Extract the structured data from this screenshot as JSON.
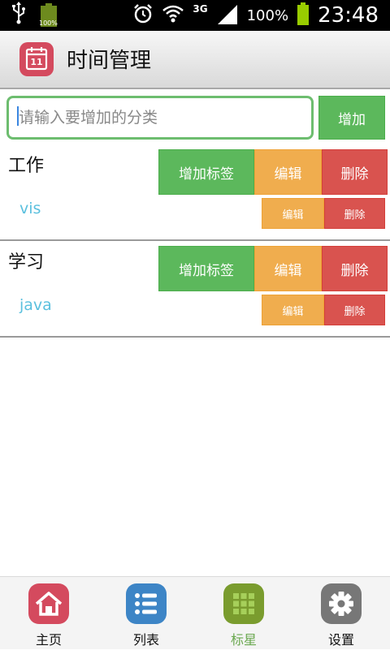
{
  "status_bar": {
    "battery_small_label": "100%",
    "network_type": "3G",
    "battery_percent": "100%",
    "time": "23:48"
  },
  "title_bar": {
    "app_icon_day": "11",
    "title": "时间管理"
  },
  "add_category": {
    "placeholder": "请输入要增加的分类",
    "value": "",
    "button_label": "增加"
  },
  "categories": [
    {
      "name": "工作",
      "add_tag_label": "增加标签",
      "edit_label": "编辑",
      "delete_label": "删除",
      "tags": [
        {
          "name": "vis",
          "edit_label": "编辑",
          "delete_label": "删除"
        }
      ]
    },
    {
      "name": "学习",
      "add_tag_label": "增加标签",
      "edit_label": "编辑",
      "delete_label": "删除",
      "tags": [
        {
          "name": "java",
          "edit_label": "编辑",
          "delete_label": "删除"
        }
      ]
    }
  ],
  "bottom_nav": [
    {
      "label": "主页",
      "icon": "home-icon",
      "color": "#d44a5e",
      "active": false
    },
    {
      "label": "列表",
      "icon": "list-icon",
      "color": "#3d85c6",
      "active": false
    },
    {
      "label": "标星",
      "icon": "grid-icon",
      "color": "#7a9c2e",
      "active": true
    },
    {
      "label": "设置",
      "icon": "gear-icon",
      "color": "#777777",
      "active": false
    }
  ],
  "colors": {
    "success": "#5cb85c",
    "warning": "#f0ad4e",
    "danger": "#d9534f",
    "info": "#5bc0de"
  }
}
